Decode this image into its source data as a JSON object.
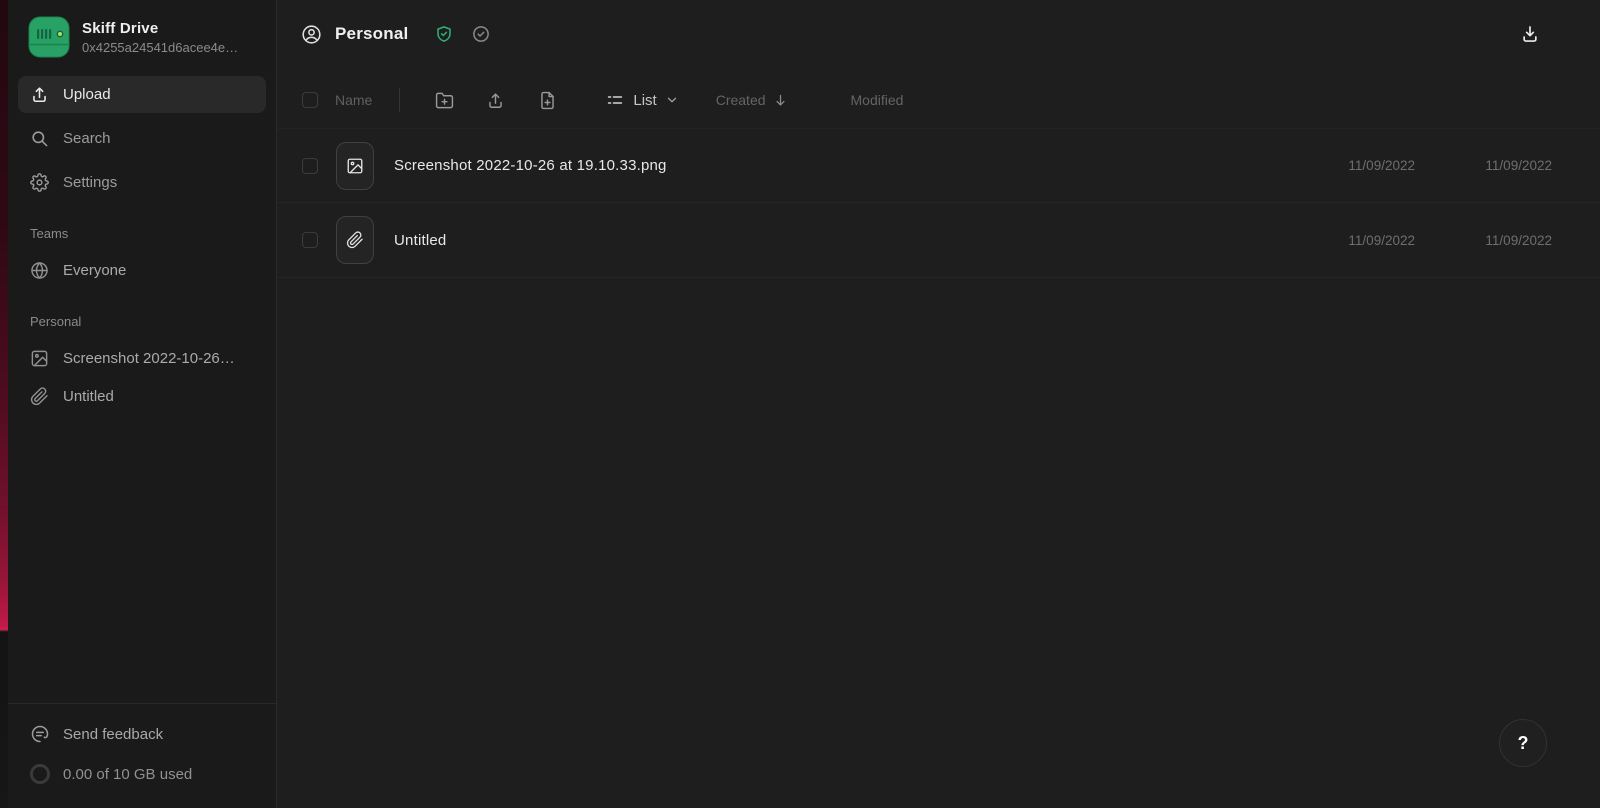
{
  "app": {
    "name": "Skiff Drive",
    "workspace_id": "0x4255a24541d6acee4e…"
  },
  "colors": {
    "logo_green": "#27a164",
    "shield_green": "#2db274",
    "edge_red": "#c01a49",
    "sidebar_bg": "#1a1a1b",
    "main_bg": "#1e1e1f"
  },
  "sidebar": {
    "upload_label": "Upload",
    "search_label": "Search",
    "settings_label": "Settings",
    "teams_section_label": "Teams",
    "everyone_label": "Everyone",
    "personal_section_label": "Personal",
    "screenshot_item_label": "Screenshot 2022-10-26…",
    "untitled_item_label": "Untitled",
    "footer": {
      "feedback_label": "Send feedback",
      "storage_label": "0.00 of 10 GB used"
    }
  },
  "main": {
    "title": "Personal",
    "toolbar": {
      "name_label": "Name",
      "view_label": "List",
      "created_label": "Created",
      "modified_label": "Modified"
    },
    "files": [
      {
        "name": "Screenshot 2022-10-26 at 19.10.33.png",
        "type": "image",
        "created": "11/09/2022",
        "modified": "11/09/2022"
      },
      {
        "name": "Untitled",
        "type": "paperclip",
        "created": "11/09/2022",
        "modified": "11/09/2022"
      }
    ],
    "help_label": "?"
  }
}
